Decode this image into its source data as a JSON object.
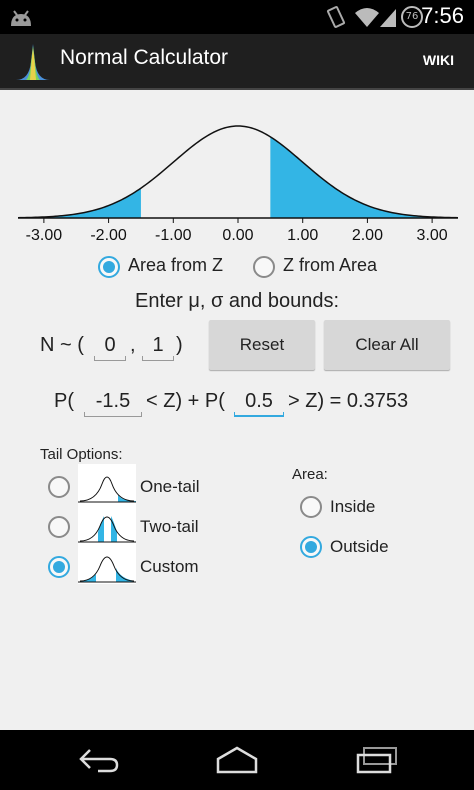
{
  "status": {
    "time": "7:56",
    "battery": "76"
  },
  "app": {
    "title": "Normal Calculator",
    "wiki_label": "WIKI"
  },
  "chart_data": {
    "type": "area",
    "xlim": [
      -3.4,
      3.4
    ],
    "ticks": [
      "-3.00",
      "-2.00",
      "-1.00",
      "0.00",
      "1.00",
      "2.00",
      "3.00"
    ],
    "tick_values": [
      -3,
      -2,
      -1,
      0,
      1,
      2,
      3
    ],
    "shaded_regions": [
      [
        -3.4,
        -1.5
      ],
      [
        0.5,
        3.4
      ]
    ],
    "shade_color": "#33b5e5"
  },
  "mode": {
    "area_from_z": "Area from Z",
    "z_from_area": "Z from Area",
    "selected": "area_from_z"
  },
  "prompt": "Enter μ, σ and bounds:",
  "dist": {
    "prefix": "N ~ (",
    "sep": ",",
    "suffix": ")",
    "mu": "0",
    "sigma": "1"
  },
  "buttons": {
    "reset": "Reset",
    "clear_all": "Clear All"
  },
  "expr": {
    "p1_open": "P(",
    "lower": "-1.5",
    "mid": "< Z) + P(",
    "upper": "0.5",
    "end": "> Z) = 0.3753"
  },
  "tail": {
    "header": "Tail Options:",
    "one": "One-tail",
    "two": "Two-tail",
    "custom": "Custom",
    "selected": "custom"
  },
  "area": {
    "header": "Area:",
    "inside": "Inside",
    "outside": "Outside",
    "selected": "outside"
  },
  "colors": {
    "accent": "#33a9df",
    "shade": "#33b5e5"
  }
}
